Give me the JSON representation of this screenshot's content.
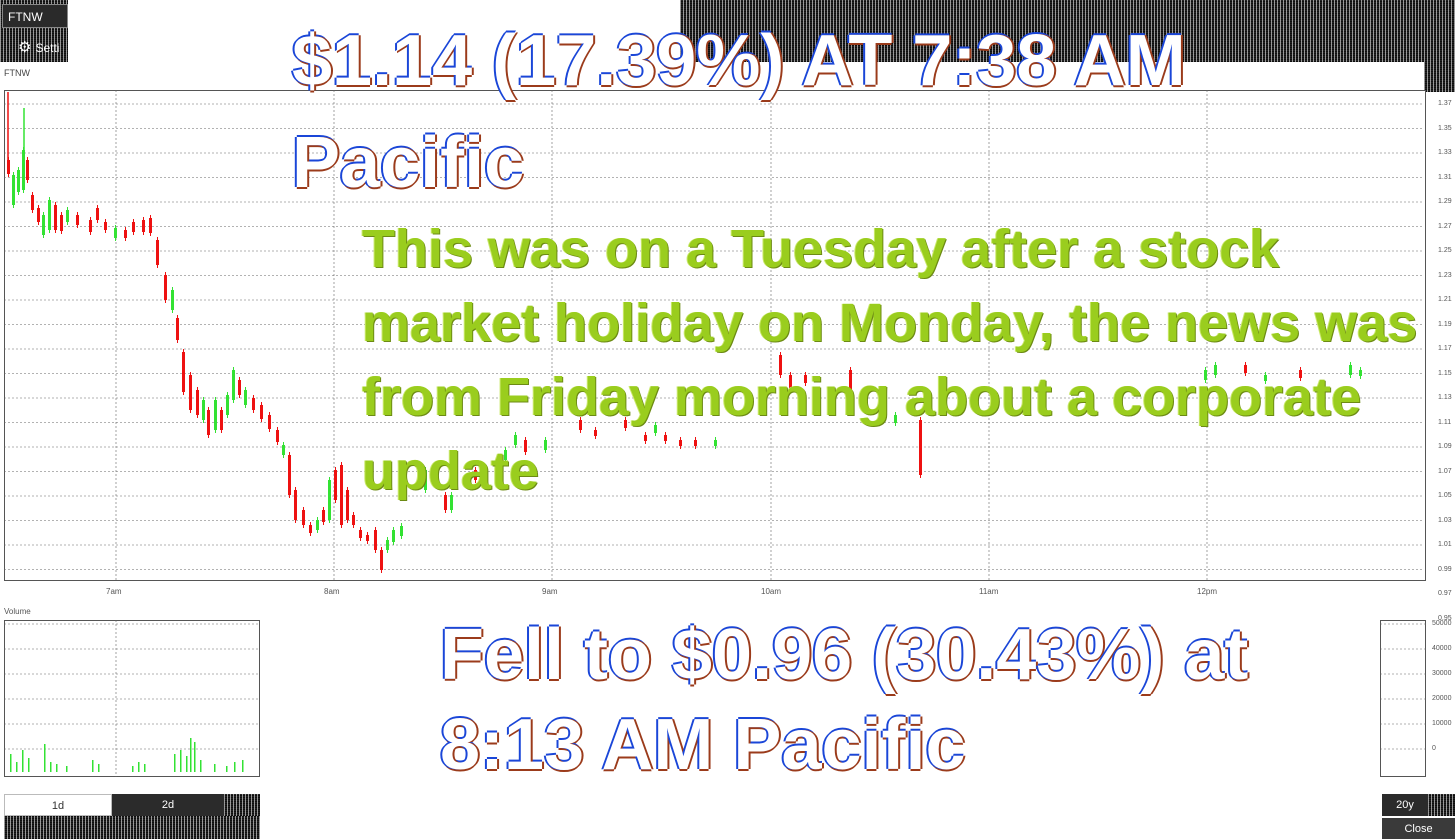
{
  "toolbar": {
    "ticker": "FTNW",
    "settings_label": "Setti",
    "symbol_label": "FTNW"
  },
  "chart": {
    "volume_label": "Volume",
    "y_ticks": [
      "1.37",
      "1.35",
      "1.33",
      "1.31",
      "1.29",
      "1.27",
      "1.25",
      "1.23",
      "1.21",
      "1.19",
      "1.17",
      "1.15",
      "1.13",
      "1.11",
      "1.09",
      "1.07",
      "1.05",
      "1.03",
      "1.01",
      "0.99",
      "0.97",
      "0.95"
    ],
    "x_ticks": [
      "7am",
      "8am",
      "9am",
      "10am",
      "11am",
      "12pm"
    ],
    "volume_ticks": [
      "50000",
      "40000",
      "30000",
      "20000",
      "10000",
      "0"
    ]
  },
  "annotations": {
    "top": "$1.14 (17.39%) AT 7:38 AM Pacific",
    "middle": "This was on a Tuesday after a stock market holiday on Monday, the news was from Friday morning about a corporate update",
    "bottom": "Fell to $0.96 (30.43%) at 8:13 AM Pacific"
  },
  "timeframes": {
    "btn_1d": "1d",
    "btn_2d": "2d",
    "btn_20y": "20y",
    "close_label": "Close"
  },
  "colors": {
    "up": "#33e233",
    "down": "#ee1111",
    "annotation_green": "#9acd1e"
  }
}
